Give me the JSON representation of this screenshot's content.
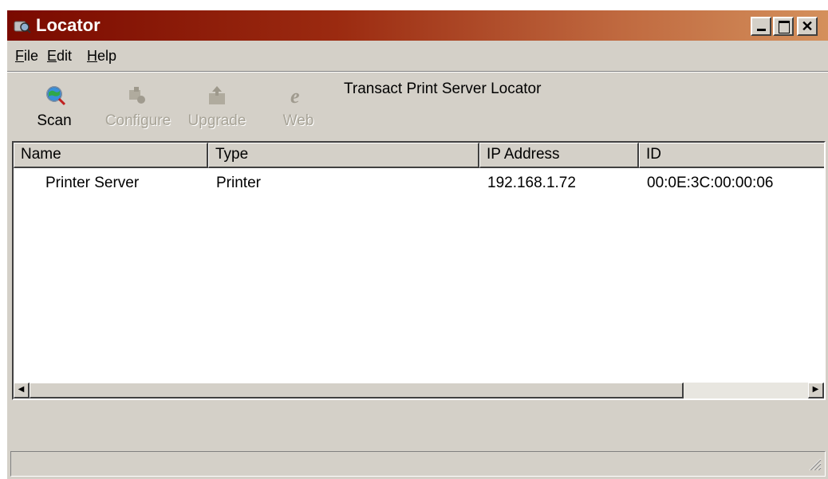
{
  "window": {
    "title": "Locator",
    "title_gradient": [
      "#7a0a00",
      "#d4905c"
    ],
    "controls": {
      "minimize": "minimize-icon",
      "maximize": "maximize-icon",
      "close": "close-icon"
    }
  },
  "menu": {
    "file": {
      "accel": "F",
      "rest": "ile"
    },
    "edit": {
      "accel": "E",
      "rest": "dit"
    },
    "help": {
      "accel": "H",
      "rest": "elp"
    }
  },
  "toolbar": {
    "scan": {
      "label": "Scan",
      "icon": "scan-globe-icon",
      "enabled": true
    },
    "configure": {
      "label": "Configure",
      "icon": "configure-icon",
      "enabled": false
    },
    "upgrade": {
      "label": "Upgrade",
      "icon": "upgrade-icon",
      "enabled": false
    },
    "web": {
      "label": "Web",
      "icon": "web-browser-icon",
      "enabled": false
    },
    "title": "Transact Print Server Locator"
  },
  "list": {
    "columns": [
      "Name",
      "Type",
      "IP Address",
      "ID"
    ],
    "rows": [
      {
        "name": "Printer Server",
        "type": "Printer",
        "ip": "192.168.1.72",
        "id": "00:0E:3C:00:00:06"
      }
    ]
  },
  "status": {
    "text": ""
  }
}
